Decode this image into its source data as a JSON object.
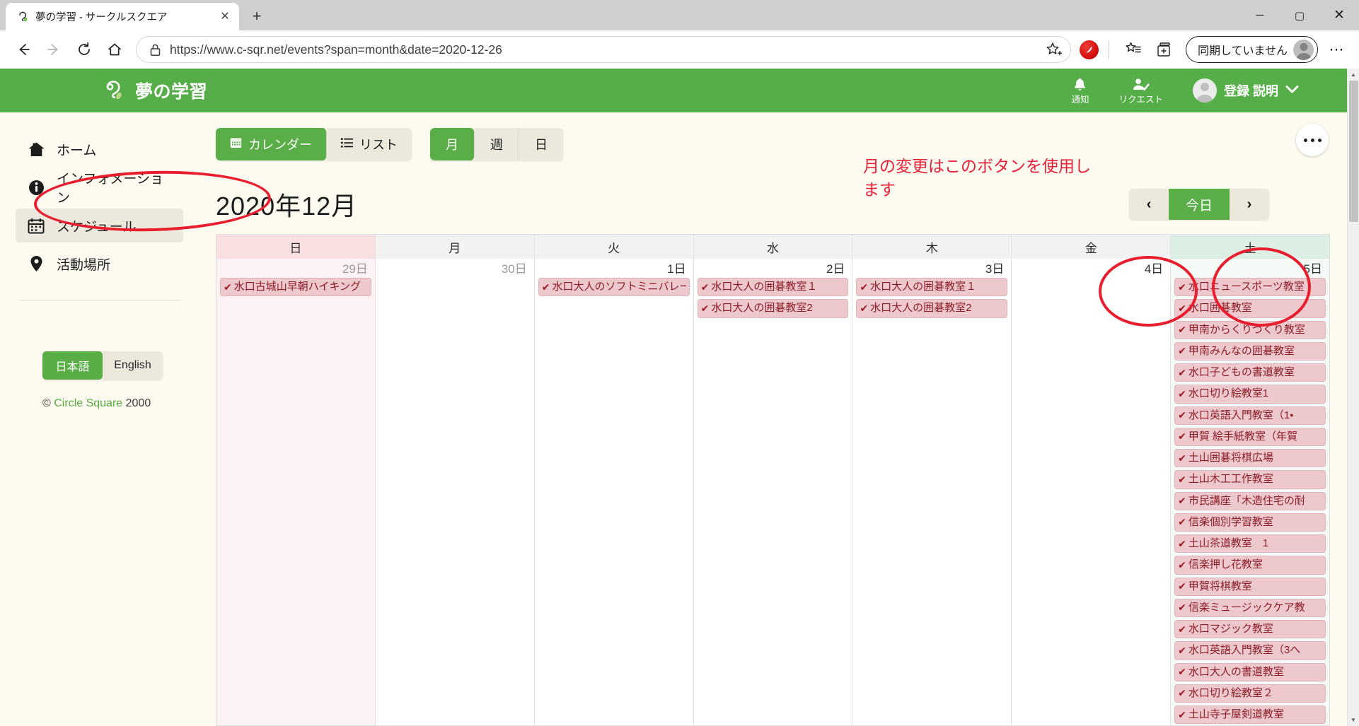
{
  "browser": {
    "tab_title": "夢の学習 - サークルスクエア",
    "tab_close": "✕",
    "new_tab": "+",
    "url": "https://www.c-sqr.net/events?span=month&date=2020-12-26",
    "profile_label": "同期していません",
    "window": {
      "minimize": "─",
      "maximize": "▢",
      "close": "✕"
    },
    "more": "⋯"
  },
  "site_header": {
    "brand": "夢の学習",
    "notifications_label": "通知",
    "requests_label": "リクエスト",
    "user_name": "登録 説明",
    "caret": "❯"
  },
  "sidebar": {
    "items": [
      {
        "label": "ホーム",
        "icon": "home-icon",
        "active": false
      },
      {
        "label": "インフォメーション",
        "icon": "info-icon",
        "active": false
      },
      {
        "label": "スケジュール",
        "icon": "calendar-icon",
        "active": true
      },
      {
        "label": "活動場所",
        "icon": "location-pin-icon",
        "active": false
      }
    ],
    "lang": {
      "ja": "日本語",
      "en": "English",
      "selected": "日本語"
    },
    "copyright": {
      "mark": "©",
      "name": "Circle Square",
      "year": "2000"
    }
  },
  "toolbar": {
    "view_buttons": [
      {
        "label": "カレンダー",
        "icon": "calendar-icon",
        "active": true
      },
      {
        "label": "リスト",
        "icon": "list-icon",
        "active": false
      }
    ],
    "span_buttons": [
      {
        "label": "月",
        "active": true
      },
      {
        "label": "週",
        "active": false
      },
      {
        "label": "日",
        "active": false
      }
    ],
    "kebab": "•••"
  },
  "calendar": {
    "month_title": "2020年12月",
    "annotation": "月の変更はこのボタンを使用します",
    "prev": "‹",
    "next": "›",
    "today": "今日",
    "day_headers": [
      "日",
      "月",
      "火",
      "水",
      "木",
      "金",
      "土"
    ],
    "columns": [
      {
        "weekday": "日",
        "daynum": "29日",
        "other_month": true,
        "events": [
          "水口古城山早朝ハイキング"
        ]
      },
      {
        "weekday": "月",
        "daynum": "30日",
        "other_month": true,
        "events": []
      },
      {
        "weekday": "火",
        "daynum": "1日",
        "other_month": false,
        "events": [
          "水口大人のソフトミニバレー"
        ]
      },
      {
        "weekday": "水",
        "daynum": "2日",
        "other_month": false,
        "events": [
          "水口大人の囲碁教室１",
          "水口大人の囲碁教室2"
        ]
      },
      {
        "weekday": "木",
        "daynum": "3日",
        "other_month": false,
        "events": [
          "水口大人の囲碁教室１",
          "水口大人の囲碁教室2"
        ]
      },
      {
        "weekday": "金",
        "daynum": "4日",
        "other_month": false,
        "events": []
      },
      {
        "weekday": "土",
        "daynum": "5日",
        "other_month": false,
        "events": [
          "水口ニュースポーツ教室",
          "水口囲碁教室",
          "甲南からくりづくり教室",
          "甲南みんなの囲碁教室",
          "水口子どもの書道教室",
          "水口切り絵教室1",
          "水口英語入門教室（1・",
          "甲賀 絵手紙教室（年賀",
          "土山囲碁将棋広場",
          "土山木工工作教室",
          "市民講座「木造住宅の耐",
          "信楽個別学習教室",
          "土山茶道教室　1",
          "信楽押し花教室",
          "甲賀将棋教室",
          "信楽ミュージックケア教",
          "水口マジック教室",
          "水口英語入門教室（3へ",
          "水口大人の書道教室",
          "水口切り絵教室２",
          "土山寺子屋剣道教室"
        ]
      }
    ],
    "event_check": "✔"
  },
  "colors": {
    "brand_green": "#55ae47",
    "page_bg": "#fdfaef",
    "annotation_red": "#e8213a",
    "event_bg": "#edc8cd",
    "event_text": "#8c1d28"
  }
}
